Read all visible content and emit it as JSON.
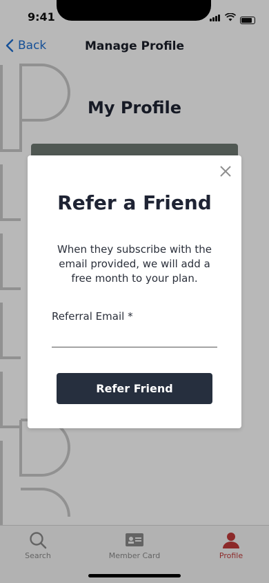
{
  "status_bar": {
    "time": "9:41"
  },
  "nav": {
    "back_label": "Back",
    "title": "Manage Profile"
  },
  "main": {
    "title": "My Profile"
  },
  "tabs": [
    {
      "label": "Search",
      "icon": "search-icon"
    },
    {
      "label": "Member Card",
      "icon": "member-card-icon"
    },
    {
      "label": "Profile",
      "icon": "profile-icon",
      "active": true
    }
  ],
  "modal": {
    "title": "Refer a Friend",
    "description": "When they subscribe with the email provided, we will add a free month to your plan.",
    "field_label": "Referral Email *",
    "email_value": "",
    "button_label": "Refer Friend"
  },
  "colors": {
    "accent": "#1f6fd1",
    "active_tab": "#c23b3b",
    "button_bg": "#262f3e"
  }
}
